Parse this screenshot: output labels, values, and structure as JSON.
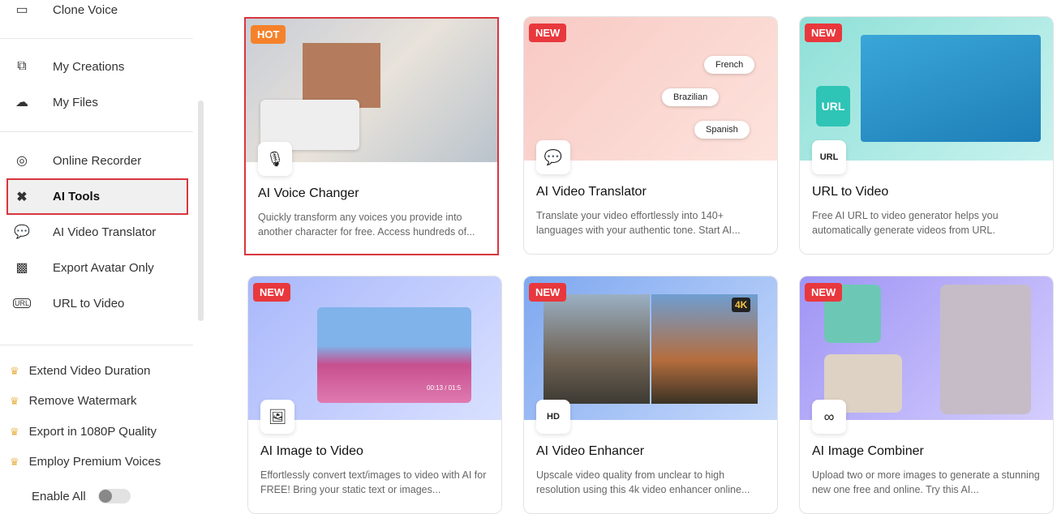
{
  "sidebar": {
    "top_partial": "Clone Voice",
    "items": [
      {
        "label": "My Creations",
        "icon": "play-square-icon"
      },
      {
        "label": "My Files",
        "icon": "cloud-upload-icon"
      },
      {
        "label": "Online Recorder",
        "icon": "webcam-icon"
      },
      {
        "label": "AI Tools",
        "icon": "tools-icon"
      },
      {
        "label": "AI Video Translator",
        "icon": "translate-icon"
      },
      {
        "label": "Export Avatar Only",
        "icon": "avatar-icon"
      },
      {
        "label": "URL to Video",
        "icon": "url-icon"
      }
    ],
    "premium": [
      "Extend Video Duration",
      "Remove Watermark",
      "Export in 1080P Quality",
      "Employ Premium Voices"
    ],
    "enable_all": "Enable All",
    "enable_all_on": false
  },
  "cards": [
    {
      "badge": "HOT",
      "title": "AI Voice Changer",
      "desc": "Quickly transform any voices you provide into another character for free. Access hundreds of...",
      "bg": "linear-gradient(135deg,#c8cdd6,#e8e2da 50%,#b9c3cc)"
    },
    {
      "badge": "NEW",
      "title": "AI Video Translator",
      "desc": "Translate your video effortlessly into 140+ languages with your authentic tone. Start AI...",
      "bg": "linear-gradient(135deg,#f8c9c4,#fde3dc)",
      "langs": [
        "French",
        "Brazilian",
        "Spanish"
      ]
    },
    {
      "badge": "NEW",
      "title": "URL to Video",
      "desc": "Free AI URL to video generator helps you automatically generate videos from URL.",
      "bg": "linear-gradient(135deg,#8fe0d8,#c8f2ee)",
      "url": "URL"
    },
    {
      "badge": "NEW",
      "title": "AI Image to Video",
      "desc": "Effortlessly convert text/images to video with AI for FREE! Bring your static text or images...",
      "bg": "linear-gradient(135deg,#a9b8fb,#d9e0ff)",
      "time": "00:13 / 01:5"
    },
    {
      "badge": "NEW",
      "title": "AI Video Enhancer",
      "desc": "Upscale video quality from unclear to high resolution using this 4k video enhancer online...",
      "bg": "linear-gradient(135deg,#7fa8f0,#c5d8fb)",
      "res": "4K"
    },
    {
      "badge": "NEW",
      "title": "AI Image Combiner",
      "desc": "Upload two or more images to generate a stunning new one free and online. Try this AI...",
      "bg": "linear-gradient(135deg,#9f95f5,#d4cdfd)"
    }
  ]
}
